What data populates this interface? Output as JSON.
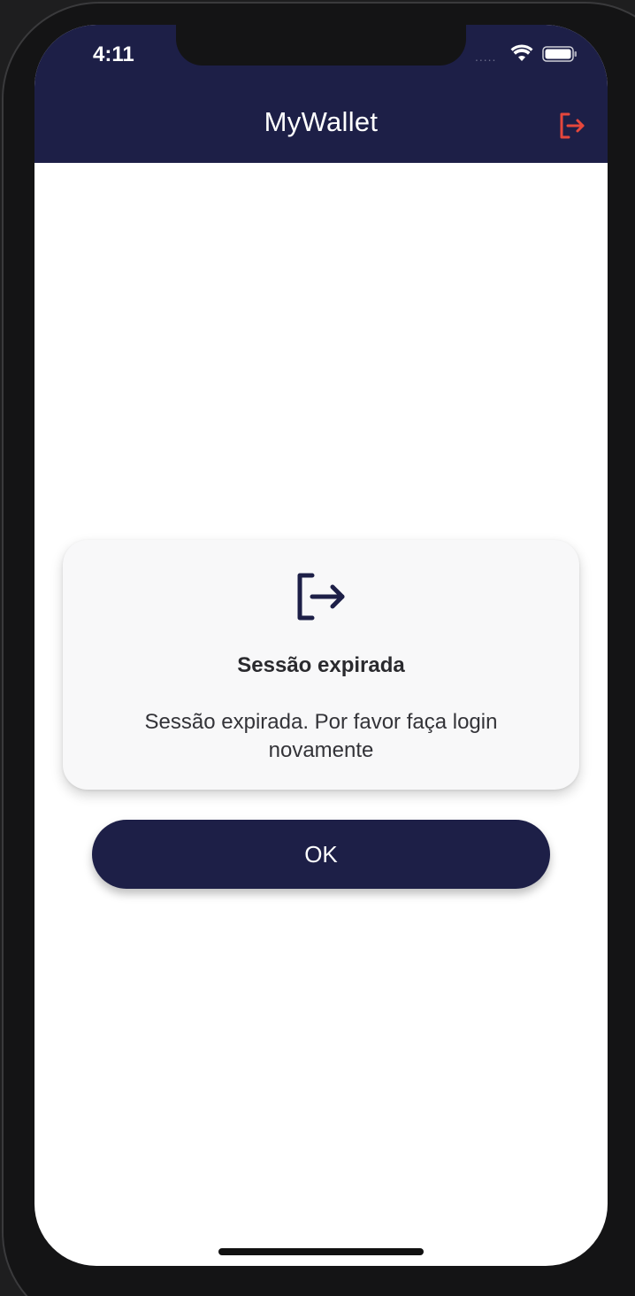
{
  "status_bar": {
    "time": "4:11",
    "signal_dots": "....."
  },
  "header": {
    "title": "MyWallet",
    "logout_icon": "logout-icon",
    "accent_color": "#e5473c",
    "background_color": "#1d1f47"
  },
  "dialog": {
    "icon": "logout-icon",
    "title": "Sessão expirada",
    "message": "Sessão expirada. Por favor faça login novamente"
  },
  "actions": {
    "ok_label": "OK"
  }
}
